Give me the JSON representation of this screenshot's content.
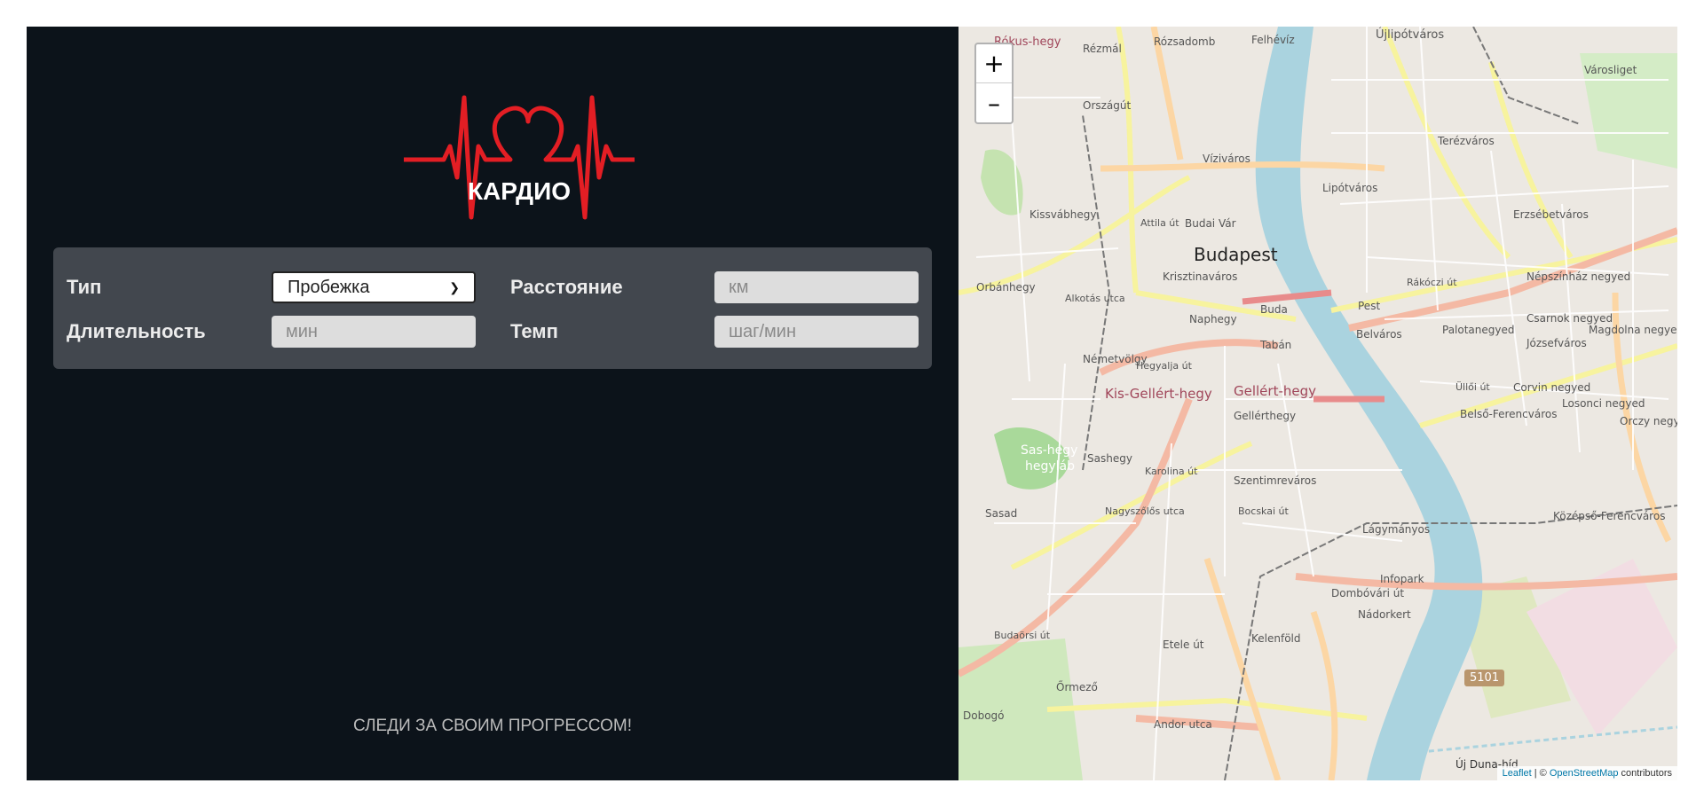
{
  "brand": {
    "name": "КАРДИО",
    "accent": "#e31e24"
  },
  "form": {
    "type_label": "Тип",
    "type_value": "Пробежка",
    "distance_label": "Расстояние",
    "distance_placeholder": "км",
    "duration_label": "Длительность",
    "duration_placeholder": "мин",
    "pace_label": "Темп",
    "pace_placeholder": "шаг/мин"
  },
  "footer": {
    "text": "СЛЕДИ ЗА СВОИМ ПРОГРЕССОМ!"
  },
  "map": {
    "zoom_in": "+",
    "zoom_out": "–",
    "attribution_leaflet": "Leaflet",
    "attribution_sep": " | © ",
    "attribution_osm": "OpenStreetMap",
    "attribution_tail": " contributors",
    "labels": {
      "city": "Budapest",
      "gellert": "Gellért-hegy",
      "kis_gellert": "Kis-Gellért-hegy",
      "sas_hegy": "Sas-hegy",
      "hegylab": "hegyláb",
      "rozsadomb": "Rózsadomb",
      "ujlipotvaros": "Újlipótváros",
      "varosliget": "Városliget",
      "terezvaros": "Terézváros",
      "erzsebetvaros": "Erzsébetváros",
      "lipotvaros": "Lipótváros",
      "belvaros": "Belváros",
      "palotanegyed": "Palotanegyed",
      "jozsefvaros": "Józsefváros",
      "lagymanyos": "Lágymányos",
      "kelenfold": "Kelenföld",
      "infopark": "Infopark",
      "nadorkert": "Nádorkert",
      "road_5101": "5101",
      "krisztinavaros": "Krisztinaváros",
      "tabon": "Tabán",
      "naphegy": "Naphegy",
      "orszagut": "Országút",
      "viziváros": "Víziváros",
      "kissvabhegy": "Kissvábhegy",
      "orbanhegy": "Orbánhegy",
      "sashegy": "Sashegy",
      "sasad": "Sasad",
      "ormezo": "Őrmező",
      "dobogo": "Dobogó",
      "szentimrevaros": "Szentimreváros",
      "rokus": "Rókus-hegy",
      "rezmal": "Rézmál",
      "felheviz": "Felhévíz",
      "budai_var": "Budai Vár",
      "buda": "Buda",
      "pest": "Pest",
      "gellerthegy_small": "Gellérthegy",
      "nemetvolgy": "Németvölgy",
      "corvin": "Corvin negyed",
      "csarnok": "Csarnok negyed",
      "belso_ferencvaros": "Belső-Ferencváros",
      "kozepso": "Középső-Ferencváros",
      "nepszinhaz": "Népszínház negyed",
      "losonci": "Losonci negyed",
      "magdolna": "Magdolna negyed",
      "orczy": "Orczy negy",
      "rakoczi": "Rákóczi út",
      "hegyalja": "Hegyalja út",
      "bocskai": "Bocskai út",
      "etele": "Etele út",
      "andor": "Andor utca",
      "budaorsi": "Budaörsi út",
      "nagyszolos": "Nagyszőlős utca",
      "dombovari": "Dombóvári út",
      "karolina": "Karolina út",
      "ulloi": "Üllői út",
      "attila": "Attila út",
      "alkotas": "Alkotás utca",
      "uj_duna": "Új Duna-híd"
    }
  }
}
